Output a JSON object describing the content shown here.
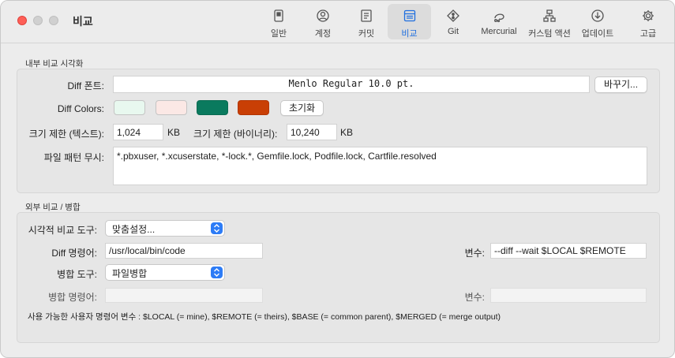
{
  "window": {
    "title": "비교"
  },
  "toolbar": {
    "items": [
      {
        "label": "일반",
        "icon": "phone-icon"
      },
      {
        "label": "계정",
        "icon": "account-icon"
      },
      {
        "label": "커밋",
        "icon": "commit-icon"
      },
      {
        "label": "비교",
        "icon": "diff-icon"
      },
      {
        "label": "Git",
        "icon": "git-icon"
      },
      {
        "label": "Mercurial",
        "icon": "mercurial-icon"
      },
      {
        "label": "커스텀 액션",
        "icon": "custom-action-icon"
      },
      {
        "label": "업데이트",
        "icon": "update-icon"
      },
      {
        "label": "고급",
        "icon": "gear-icon"
      }
    ],
    "active": "비교",
    "accent": "#1f6fe0"
  },
  "internal": {
    "title": "내부 비교 시각화",
    "font_label": "Diff 폰트:",
    "font_value": "Menlo Regular 10.0 pt.",
    "change_button": "바꾸기...",
    "colors_label": "Diff Colors:",
    "colors": [
      "#e8f8ef",
      "#fbe8e5",
      "#0a7a5e",
      "#c93f05"
    ],
    "reset_button": "초기화",
    "text_limit_label": "크기 제한 (텍스트):",
    "text_limit_value": "1,024",
    "text_limit_unit": "KB",
    "binary_limit_label": "크기 제한 (바이너리):",
    "binary_limit_value": "10,240",
    "binary_limit_unit": "KB",
    "ignore_label": "파일 패턴 무시:",
    "ignore_value": "*.pbxuser, *.xcuserstate, *-lock.*, Gemfile.lock, Podfile.lock, Cartfile.resolved"
  },
  "external": {
    "title": "외부 비교 / 병합",
    "visual_tool_label": "시각적 비교 도구:",
    "visual_tool_value": "맞춤설정...",
    "diff_cmd_label": "Diff 명령어:",
    "diff_cmd_value": "/usr/local/bin/code",
    "diff_args_label": "변수:",
    "diff_args_value": "--diff --wait $LOCAL $REMOTE",
    "merge_tool_label": "병합 도구:",
    "merge_tool_value": "파일병합",
    "merge_cmd_label": "병합 명령어:",
    "merge_cmd_value": "",
    "merge_args_label": "변수:",
    "merge_args_value": "",
    "note": "사용 가능한 사용자 명령어 변수 : $LOCAL (= mine), $REMOTE (= theirs), $BASE (= common parent), $MERGED (= merge output)"
  }
}
